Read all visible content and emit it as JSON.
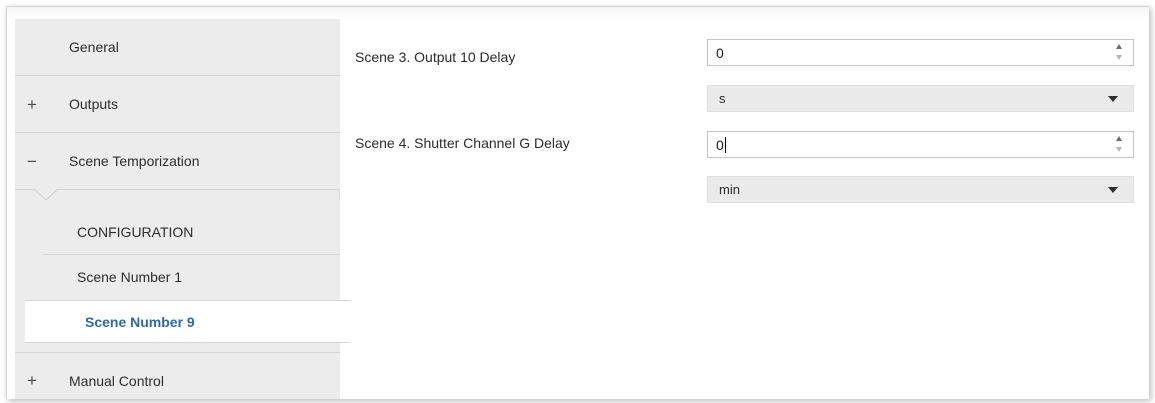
{
  "sidebar": {
    "items": [
      {
        "label": "General",
        "sign": ""
      },
      {
        "label": "Outputs",
        "sign": "+"
      },
      {
        "label": "Scene Temporization",
        "sign": "−"
      },
      {
        "label": "Manual Control",
        "sign": "+"
      }
    ],
    "subitems": [
      {
        "label": "CONFIGURATION",
        "selected": false
      },
      {
        "label": "Scene Number 1",
        "selected": false
      },
      {
        "label": "Scene Number 9",
        "selected": true
      }
    ]
  },
  "params": [
    {
      "label": "Scene 3. Output 10 Delay",
      "value": "0",
      "unit": "s",
      "focused": false
    },
    {
      "label": "Scene 4. Shutter Channel G Delay",
      "value": "0",
      "unit": "min",
      "focused": true
    }
  ],
  "colors": {
    "active_text": "#2f6aa6",
    "sidebar_bg": "#ececec"
  },
  "icons": {
    "expand": "plus-icon",
    "collapse": "minus-icon",
    "spin_up": "triangle-up-icon",
    "spin_down": "triangle-down-icon",
    "dropdown": "chevron-down-icon"
  }
}
